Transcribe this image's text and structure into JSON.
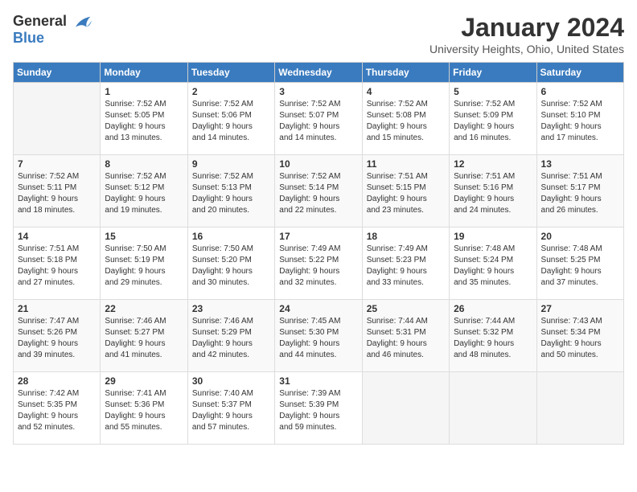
{
  "logo": {
    "text_general": "General",
    "text_blue": "Blue"
  },
  "header": {
    "month": "January 2024",
    "location": "University Heights, Ohio, United States"
  },
  "weekdays": [
    "Sunday",
    "Monday",
    "Tuesday",
    "Wednesday",
    "Thursday",
    "Friday",
    "Saturday"
  ],
  "weeks": [
    [
      {
        "day": "",
        "sunrise": "",
        "sunset": "",
        "daylight": ""
      },
      {
        "day": "1",
        "sunrise": "Sunrise: 7:52 AM",
        "sunset": "Sunset: 5:05 PM",
        "daylight": "Daylight: 9 hours and 13 minutes."
      },
      {
        "day": "2",
        "sunrise": "Sunrise: 7:52 AM",
        "sunset": "Sunset: 5:06 PM",
        "daylight": "Daylight: 9 hours and 14 minutes."
      },
      {
        "day": "3",
        "sunrise": "Sunrise: 7:52 AM",
        "sunset": "Sunset: 5:07 PM",
        "daylight": "Daylight: 9 hours and 14 minutes."
      },
      {
        "day": "4",
        "sunrise": "Sunrise: 7:52 AM",
        "sunset": "Sunset: 5:08 PM",
        "daylight": "Daylight: 9 hours and 15 minutes."
      },
      {
        "day": "5",
        "sunrise": "Sunrise: 7:52 AM",
        "sunset": "Sunset: 5:09 PM",
        "daylight": "Daylight: 9 hours and 16 minutes."
      },
      {
        "day": "6",
        "sunrise": "Sunrise: 7:52 AM",
        "sunset": "Sunset: 5:10 PM",
        "daylight": "Daylight: 9 hours and 17 minutes."
      }
    ],
    [
      {
        "day": "7",
        "sunrise": "Sunrise: 7:52 AM",
        "sunset": "Sunset: 5:11 PM",
        "daylight": "Daylight: 9 hours and 18 minutes."
      },
      {
        "day": "8",
        "sunrise": "Sunrise: 7:52 AM",
        "sunset": "Sunset: 5:12 PM",
        "daylight": "Daylight: 9 hours and 19 minutes."
      },
      {
        "day": "9",
        "sunrise": "Sunrise: 7:52 AM",
        "sunset": "Sunset: 5:13 PM",
        "daylight": "Daylight: 9 hours and 20 minutes."
      },
      {
        "day": "10",
        "sunrise": "Sunrise: 7:52 AM",
        "sunset": "Sunset: 5:14 PM",
        "daylight": "Daylight: 9 hours and 22 minutes."
      },
      {
        "day": "11",
        "sunrise": "Sunrise: 7:51 AM",
        "sunset": "Sunset: 5:15 PM",
        "daylight": "Daylight: 9 hours and 23 minutes."
      },
      {
        "day": "12",
        "sunrise": "Sunrise: 7:51 AM",
        "sunset": "Sunset: 5:16 PM",
        "daylight": "Daylight: 9 hours and 24 minutes."
      },
      {
        "day": "13",
        "sunrise": "Sunrise: 7:51 AM",
        "sunset": "Sunset: 5:17 PM",
        "daylight": "Daylight: 9 hours and 26 minutes."
      }
    ],
    [
      {
        "day": "14",
        "sunrise": "Sunrise: 7:51 AM",
        "sunset": "Sunset: 5:18 PM",
        "daylight": "Daylight: 9 hours and 27 minutes."
      },
      {
        "day": "15",
        "sunrise": "Sunrise: 7:50 AM",
        "sunset": "Sunset: 5:19 PM",
        "daylight": "Daylight: 9 hours and 29 minutes."
      },
      {
        "day": "16",
        "sunrise": "Sunrise: 7:50 AM",
        "sunset": "Sunset: 5:20 PM",
        "daylight": "Daylight: 9 hours and 30 minutes."
      },
      {
        "day": "17",
        "sunrise": "Sunrise: 7:49 AM",
        "sunset": "Sunset: 5:22 PM",
        "daylight": "Daylight: 9 hours and 32 minutes."
      },
      {
        "day": "18",
        "sunrise": "Sunrise: 7:49 AM",
        "sunset": "Sunset: 5:23 PM",
        "daylight": "Daylight: 9 hours and 33 minutes."
      },
      {
        "day": "19",
        "sunrise": "Sunrise: 7:48 AM",
        "sunset": "Sunset: 5:24 PM",
        "daylight": "Daylight: 9 hours and 35 minutes."
      },
      {
        "day": "20",
        "sunrise": "Sunrise: 7:48 AM",
        "sunset": "Sunset: 5:25 PM",
        "daylight": "Daylight: 9 hours and 37 minutes."
      }
    ],
    [
      {
        "day": "21",
        "sunrise": "Sunrise: 7:47 AM",
        "sunset": "Sunset: 5:26 PM",
        "daylight": "Daylight: 9 hours and 39 minutes."
      },
      {
        "day": "22",
        "sunrise": "Sunrise: 7:46 AM",
        "sunset": "Sunset: 5:27 PM",
        "daylight": "Daylight: 9 hours and 41 minutes."
      },
      {
        "day": "23",
        "sunrise": "Sunrise: 7:46 AM",
        "sunset": "Sunset: 5:29 PM",
        "daylight": "Daylight: 9 hours and 42 minutes."
      },
      {
        "day": "24",
        "sunrise": "Sunrise: 7:45 AM",
        "sunset": "Sunset: 5:30 PM",
        "daylight": "Daylight: 9 hours and 44 minutes."
      },
      {
        "day": "25",
        "sunrise": "Sunrise: 7:44 AM",
        "sunset": "Sunset: 5:31 PM",
        "daylight": "Daylight: 9 hours and 46 minutes."
      },
      {
        "day": "26",
        "sunrise": "Sunrise: 7:44 AM",
        "sunset": "Sunset: 5:32 PM",
        "daylight": "Daylight: 9 hours and 48 minutes."
      },
      {
        "day": "27",
        "sunrise": "Sunrise: 7:43 AM",
        "sunset": "Sunset: 5:34 PM",
        "daylight": "Daylight: 9 hours and 50 minutes."
      }
    ],
    [
      {
        "day": "28",
        "sunrise": "Sunrise: 7:42 AM",
        "sunset": "Sunset: 5:35 PM",
        "daylight": "Daylight: 9 hours and 52 minutes."
      },
      {
        "day": "29",
        "sunrise": "Sunrise: 7:41 AM",
        "sunset": "Sunset: 5:36 PM",
        "daylight": "Daylight: 9 hours and 55 minutes."
      },
      {
        "day": "30",
        "sunrise": "Sunrise: 7:40 AM",
        "sunset": "Sunset: 5:37 PM",
        "daylight": "Daylight: 9 hours and 57 minutes."
      },
      {
        "day": "31",
        "sunrise": "Sunrise: 7:39 AM",
        "sunset": "Sunset: 5:39 PM",
        "daylight": "Daylight: 9 hours and 59 minutes."
      },
      {
        "day": "",
        "sunrise": "",
        "sunset": "",
        "daylight": ""
      },
      {
        "day": "",
        "sunrise": "",
        "sunset": "",
        "daylight": ""
      },
      {
        "day": "",
        "sunrise": "",
        "sunset": "",
        "daylight": ""
      }
    ]
  ]
}
